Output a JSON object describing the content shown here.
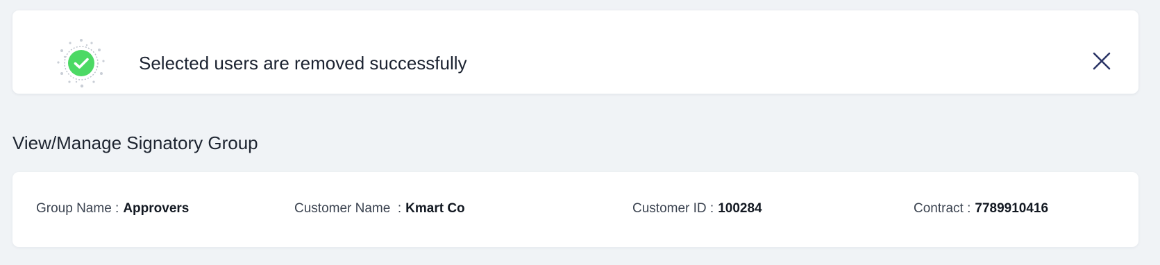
{
  "toast": {
    "message": "Selected users are removed successfully",
    "icon": "check-circle-icon",
    "close_icon": "close-icon",
    "accent_color": "#4cd964"
  },
  "page": {
    "title": "View/Manage Signatory Group"
  },
  "details": {
    "group_name_label": "Group Name :",
    "group_name_value": "Approvers",
    "customer_name_label": "Customer Name  :",
    "customer_name_value": "Kmart Co",
    "customer_id_label": "Customer ID :",
    "customer_id_value": "100284",
    "contract_label": "Contract :",
    "contract_value": "7789910416"
  }
}
